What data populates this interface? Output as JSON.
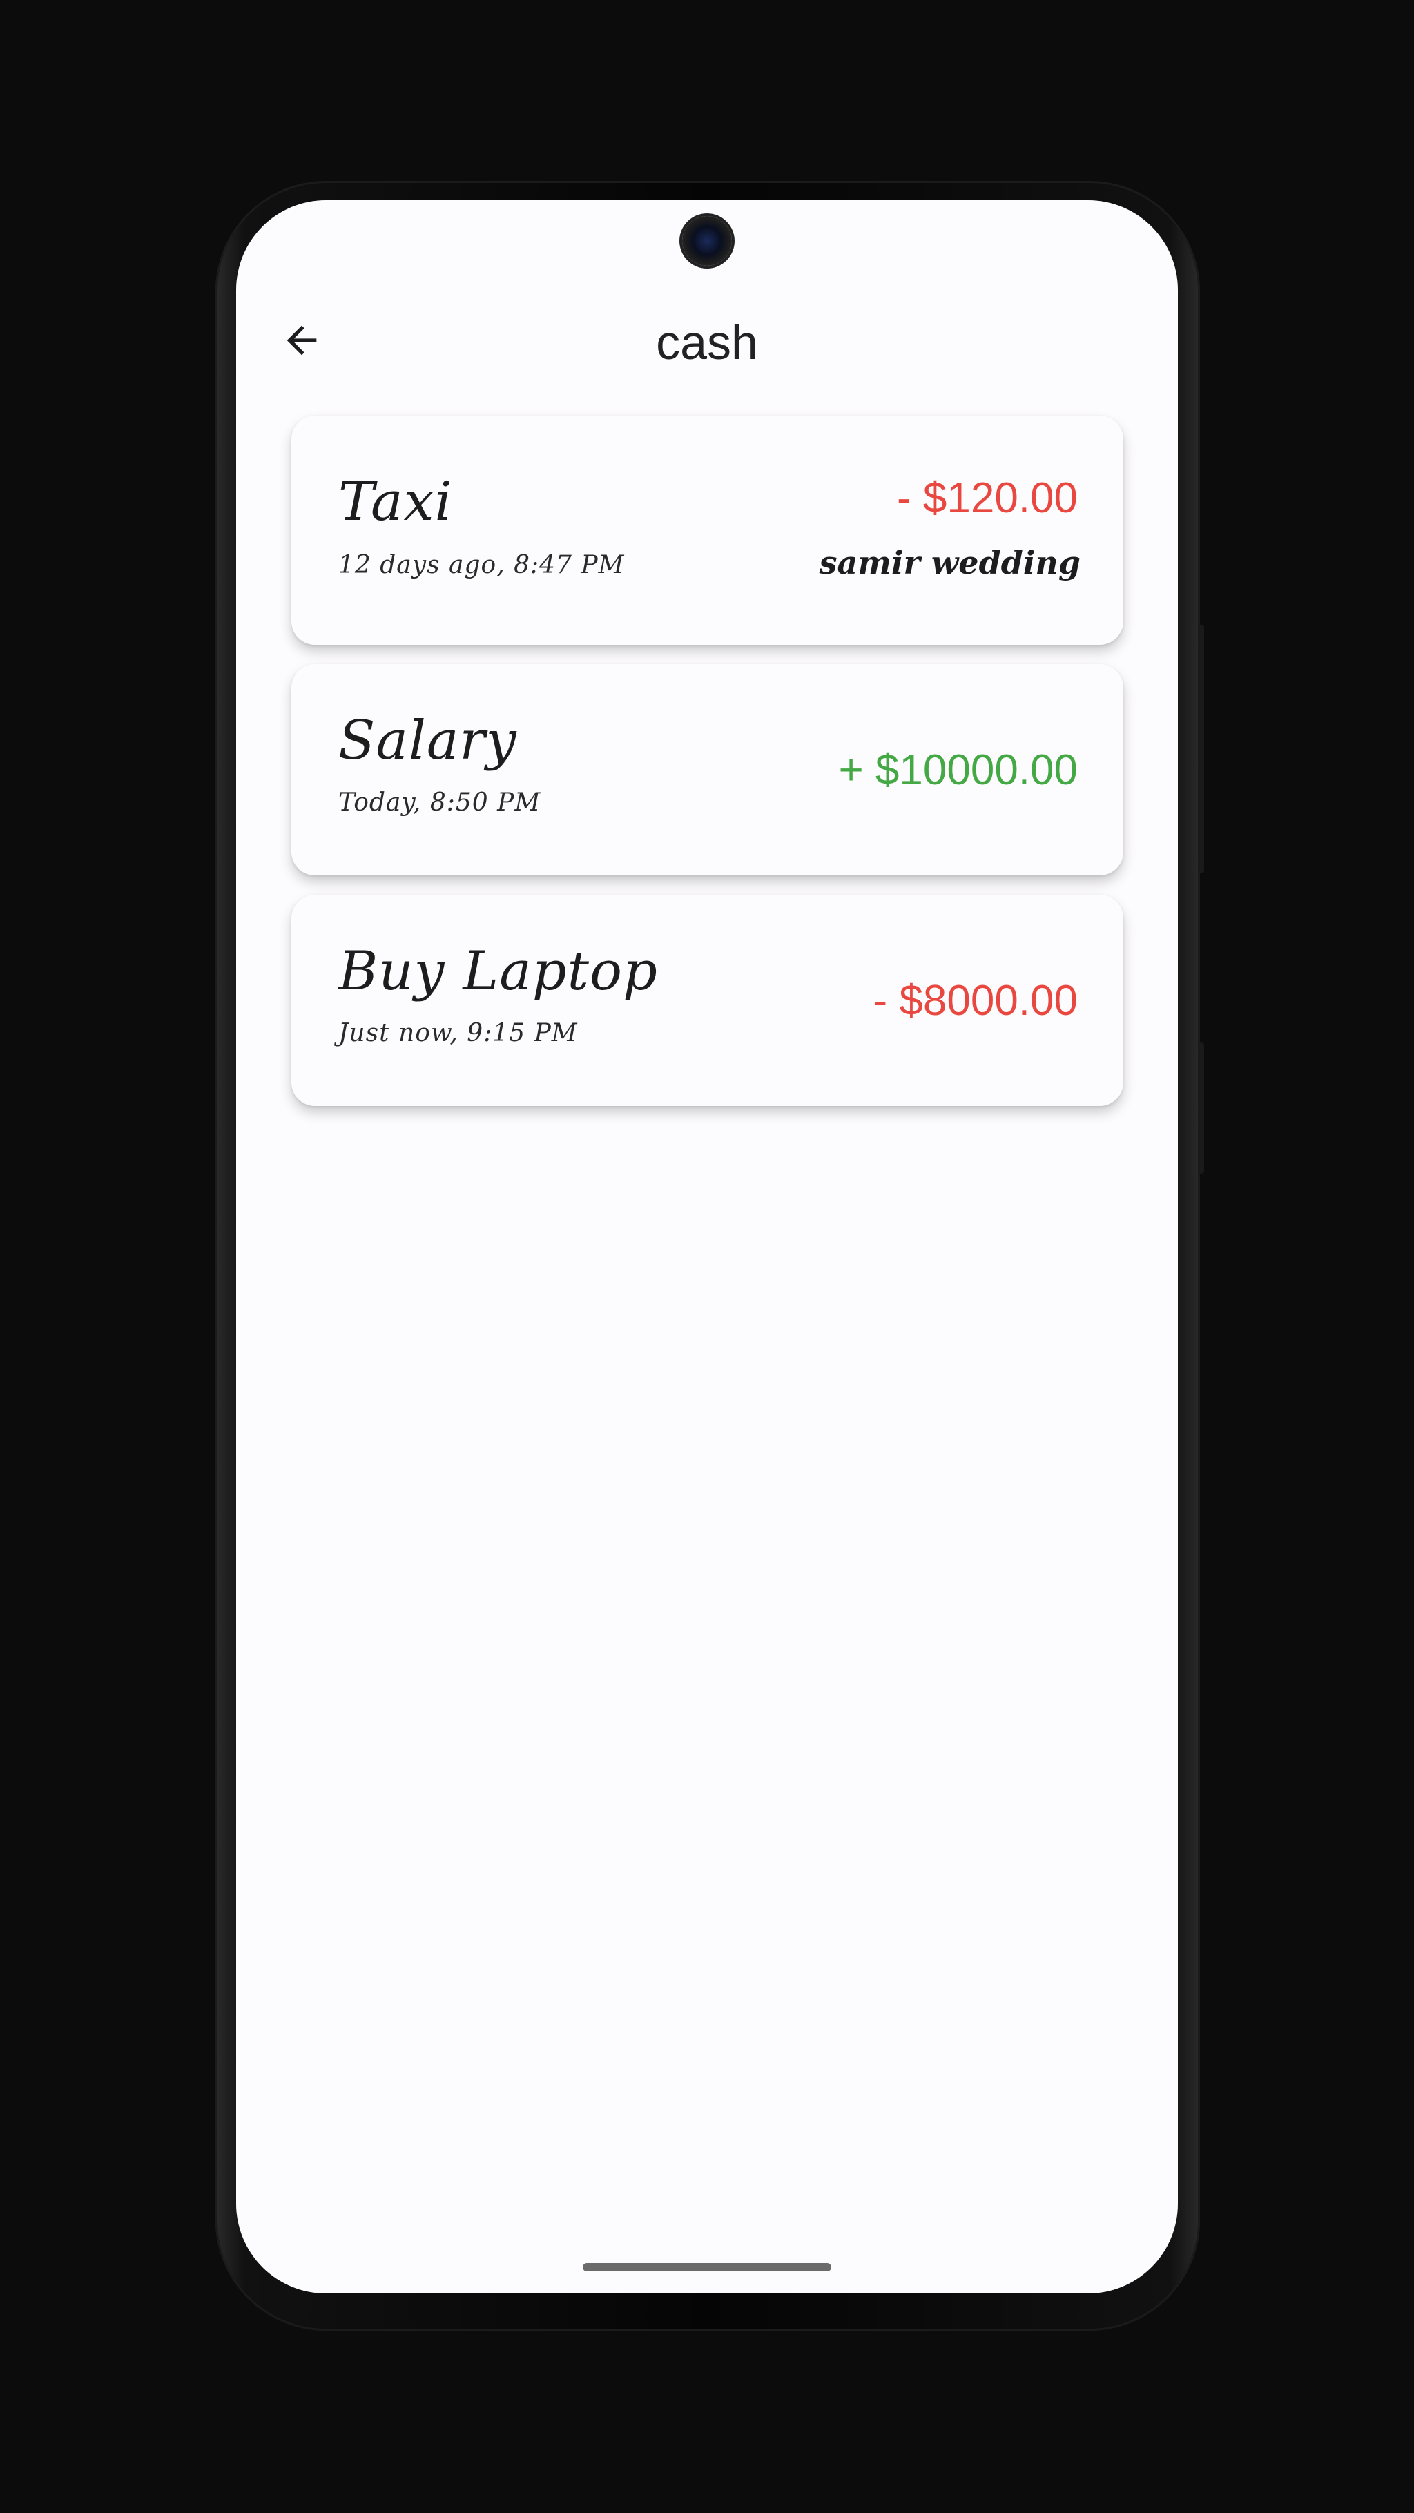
{
  "app": {
    "title": "cash"
  },
  "navigation": {
    "back_icon": "arrow-left-icon"
  },
  "colors": {
    "expense": "#e8483f",
    "income": "#44a845",
    "background": "#fcfbfd",
    "device": "#0c0c0c"
  },
  "transactions": [
    {
      "name": "Taxi",
      "time": "12 days ago, 8:47 PM",
      "amount": "- $120.00",
      "note": "samir wedding",
      "kind": "expense"
    },
    {
      "name": "Salary",
      "time": "Today, 8:50 PM",
      "amount": "+ $10000.00",
      "kind": "income"
    },
    {
      "name": "Buy Laptop",
      "time": "Just now, 9:15 PM",
      "amount": "- $8000.00",
      "kind": "expense"
    }
  ]
}
